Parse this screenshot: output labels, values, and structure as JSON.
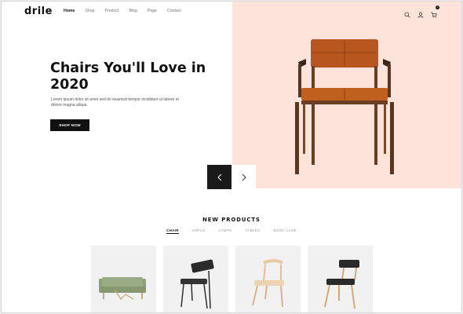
{
  "header": {
    "logo": "drile",
    "nav": [
      "Home",
      "Shop",
      "Product",
      "Blog",
      "Page",
      "Contact"
    ],
    "cart_count": "0"
  },
  "hero": {
    "title": "Chairs You'll Love in 2020",
    "description": "Lorem ipsum dolor sit amet sed do eiusmod tempor incididunt ut labore et dolore magna aliqua.",
    "button": "SHOP NOW"
  },
  "products": {
    "title": "NEW PRODUCTS",
    "tabs": [
      "CHAIR",
      "SOFAS",
      "LAMPS",
      "TABLES",
      "BOOK CASE"
    ],
    "active_tab": "CHAIR"
  },
  "colors": {
    "hero_bg": "#fde3da",
    "accent": "#111111",
    "leather": "#b8561f"
  }
}
